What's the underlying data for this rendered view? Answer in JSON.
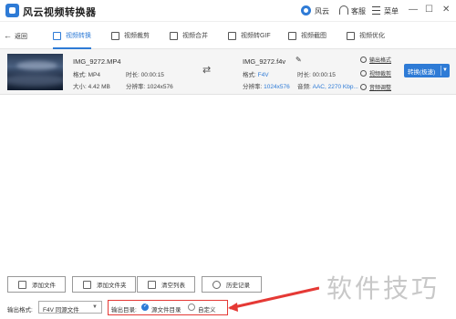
{
  "app": {
    "title": "风云视频转换器",
    "user_name": "风云",
    "support_label": "客服",
    "menu_label": "菜单",
    "minimize": "—",
    "maximize": "☐",
    "close": "✕"
  },
  "nav": {
    "back_label": "返回",
    "tabs": [
      {
        "label": "视频转换",
        "icon": "video-convert-icon",
        "active": true
      },
      {
        "label": "视频裁剪",
        "icon": "video-crop-icon",
        "active": false
      },
      {
        "label": "视频合并",
        "icon": "video-merge-icon",
        "active": false
      },
      {
        "label": "视频转GIF",
        "icon": "gif-icon",
        "active": false
      },
      {
        "label": "视频截图",
        "icon": "screenshot-icon",
        "active": false
      },
      {
        "label": "视频优化",
        "icon": "optimize-icon",
        "active": false
      }
    ]
  },
  "file": {
    "source_name": "IMG_9272.MP4",
    "source_format_label": "格式:",
    "source_format": "MP4",
    "source_duration_label": "时长:",
    "source_duration": "00:00:15",
    "source_size_label": "大小:",
    "source_size": "4.42 MB",
    "source_resolution_label": "分辨率:",
    "source_resolution": "1024x576",
    "target_name": "IMG_9272.f4v",
    "target_format_label": "格式:",
    "target_format": "F4V",
    "target_duration_label": "时长:",
    "target_duration": "00:00:15",
    "target_resolution_label": "分辨率:",
    "target_resolution": "1024x576",
    "target_audio_label": "音频:",
    "target_audio": "AAC, 2270 Kbp...",
    "side_actions": [
      "输出格式",
      "视频裁剪",
      "音频调整"
    ],
    "convert_label": "转换(极速)"
  },
  "actions": [
    {
      "label": "添加文件",
      "icon": "add-file-icon"
    },
    {
      "label": "添加文件夹",
      "icon": "add-folder-icon"
    },
    {
      "label": "清空列表",
      "icon": "clear-list-icon"
    },
    {
      "label": "历史记录",
      "icon": "history-icon"
    }
  ],
  "output": {
    "format_label": "输出格式:",
    "format_value": "F4V 同源文件",
    "dir_label": "输出目录:",
    "dir_options": [
      {
        "label": "源文件目录",
        "checked": true
      },
      {
        "label": "自定义",
        "checked": false
      }
    ]
  },
  "watermark": "软件技巧",
  "colors": {
    "accent": "#2e7bd6",
    "highlight": "#e53935"
  }
}
